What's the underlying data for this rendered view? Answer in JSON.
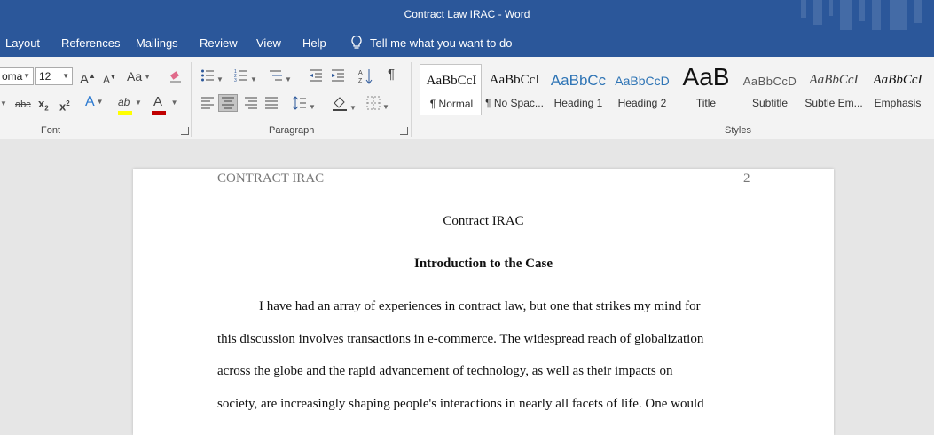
{
  "window": {
    "title": "Contract Law IRAC  -  Word"
  },
  "menu": {
    "items": [
      "Layout",
      "References",
      "Mailings",
      "Review",
      "View",
      "Help"
    ],
    "tell_me": "Tell me what you want to do",
    "tell_icon": "lightbulb-icon"
  },
  "font_group": {
    "label": "Font",
    "font_name": "oma",
    "font_size": "12",
    "grow_label": "A",
    "shrink_label": "A",
    "case_label": "Aa",
    "strike_label": "abc",
    "sub_label": "x",
    "sup_label": "x",
    "effects_label": "A",
    "highlight_label": "ab",
    "color_label": "A",
    "highlight_color": "#ffff00",
    "font_color": "#c00000"
  },
  "paragraph_group": {
    "label": "Paragraph",
    "pilcrow": "¶"
  },
  "styles_group": {
    "label": "Styles",
    "items": [
      {
        "sample": "AaBbCcI",
        "name": "¶ Normal"
      },
      {
        "sample": "AaBbCcI",
        "name": "¶ No Spac..."
      },
      {
        "sample": "AaBbCc",
        "name": "Heading 1"
      },
      {
        "sample": "AaBbCcD",
        "name": "Heading 2"
      },
      {
        "sample": "AaB",
        "name": "Title"
      },
      {
        "sample": "AaBbCcD",
        "name": "Subtitle"
      },
      {
        "sample": "AaBbCcI",
        "name": "Subtle Em..."
      },
      {
        "sample": "AaBbCcI",
        "name": "Emphasis"
      }
    ]
  },
  "document": {
    "header_left": "CONTRACT IRAC",
    "page_number": "2",
    "title": "Contract IRAC",
    "heading": "Introduction to the Case",
    "lines": [
      "I have had an array of experiences in contract law, but one that strikes my mind for",
      "this discussion involves transactions in e-commerce. The widespread reach of globalization",
      "across the globe and the rapid advancement of technology, as well as their impacts on",
      "society, are increasingly shaping people's interactions in nearly all facets of life. One would"
    ]
  }
}
